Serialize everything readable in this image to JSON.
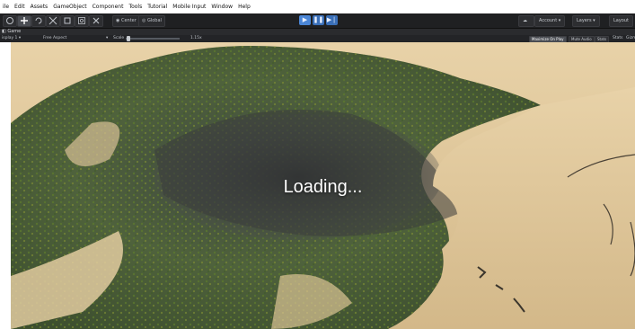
{
  "menu": [
    "ile",
    "Edit",
    "Assets",
    "GameObject",
    "Component",
    "Tools",
    "Tutorial",
    "Mobile Input",
    "Window",
    "Help"
  ],
  "toolbar": {
    "tools": [
      "hand-icon",
      "move-icon",
      "rotate-icon",
      "scale-icon",
      "rect-icon",
      "transform-icon",
      "custom-icon"
    ],
    "pivot_label": "Center",
    "space_label": "Global",
    "account_label": "Account",
    "layers_label": "Layers",
    "layout_label": "Layout"
  },
  "tab": {
    "label": "Game"
  },
  "gamebar": {
    "display_label": "isplay 1",
    "aspect_label": "Free Aspect",
    "scale_label": "Scale",
    "scale_value": "1.15x",
    "maximize_label": "Maximize On Play",
    "mute_label": "Mute Audio",
    "stats_label": "Stats",
    "gizmos_label": "Gizmos",
    "stats_short": "Stats",
    "gizmo_short": "Gizm"
  },
  "viewport": {
    "loading_text": "Loading..."
  },
  "colors": {
    "toolbar_bg": "#1f2022",
    "play_accent": "#3a6fb8",
    "sand": "#ddc39a",
    "grass": "#4f6a3a",
    "rock": "#3c3f3f"
  }
}
